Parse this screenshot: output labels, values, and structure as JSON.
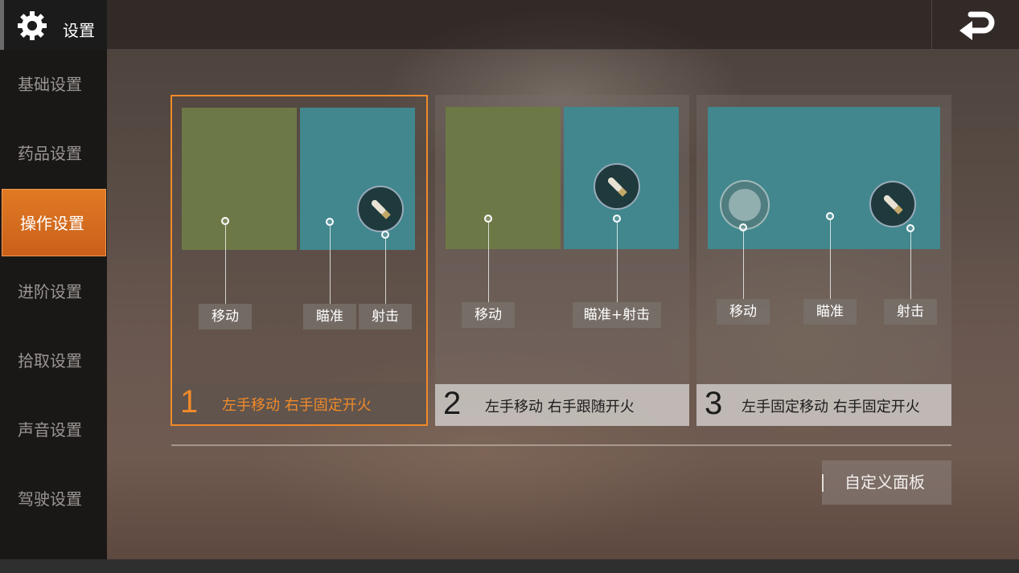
{
  "header": {
    "title": "设置"
  },
  "sidebar": {
    "items": [
      {
        "label": "基础设置"
      },
      {
        "label": "药品设置"
      },
      {
        "label": "操作设置",
        "active": true
      },
      {
        "label": "进阶设置"
      },
      {
        "label": "拾取设置"
      },
      {
        "label": "声音设置"
      },
      {
        "label": "驾驶设置"
      }
    ]
  },
  "modes": [
    {
      "number": "1",
      "description": "左手移动 右手固定开火",
      "selected": true,
      "tags": [
        "移动",
        "瞄准",
        "射击"
      ]
    },
    {
      "number": "2",
      "description": "左手移动 右手跟随开火",
      "selected": false,
      "tags": [
        "移动",
        "瞄准+射击"
      ]
    },
    {
      "number": "3",
      "description": "左手固定移动 右手固定开火",
      "selected": false,
      "tags": [
        "移动",
        "瞄准",
        "射击"
      ]
    }
  ],
  "custom_button": {
    "label": "自定义面板"
  },
  "colors": {
    "accent": "#f08a2a",
    "move_zone": "#6d7847",
    "aim_zone": "#41878d",
    "sidebar_bg": "#1a1817"
  },
  "icons": {
    "header": "gear-icon",
    "back": "return-arrow-icon",
    "fire": "bullet-fire-icon",
    "joystick": "joystick-icon"
  }
}
